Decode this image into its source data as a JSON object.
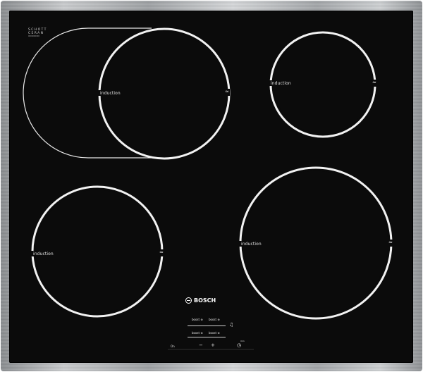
{
  "glass": {
    "brand_mark": "SCHOTT CERAN",
    "brand_line1": "SCHOTT",
    "brand_line2": "CERAN",
    "serial": "0000000000",
    "appliance_brand": "BOSCH"
  },
  "zones": {
    "front_left": {
      "label": "induction",
      "chevron": "≈"
    },
    "rear_left": {
      "label": "induction",
      "chevron": "≈"
    },
    "rear_right": {
      "label": "induction",
      "chevron": "≈"
    },
    "front_right": {
      "label": "induction",
      "chevron": "≈"
    }
  },
  "controls": {
    "select_1": "boost ⊕",
    "select_2": "boost ⊕",
    "select_3": "boost ⊕",
    "select_4": "boost ⊕",
    "power": "On",
    "minus": "−",
    "plus": "+",
    "timer_small_label": "min",
    "icons": {
      "bell": "bell-icon",
      "timer": "timer-icon"
    }
  },
  "colors": {
    "glass": "#0b0b0b",
    "ring": "#f2f2f2",
    "frame": "#b8bbbe"
  }
}
